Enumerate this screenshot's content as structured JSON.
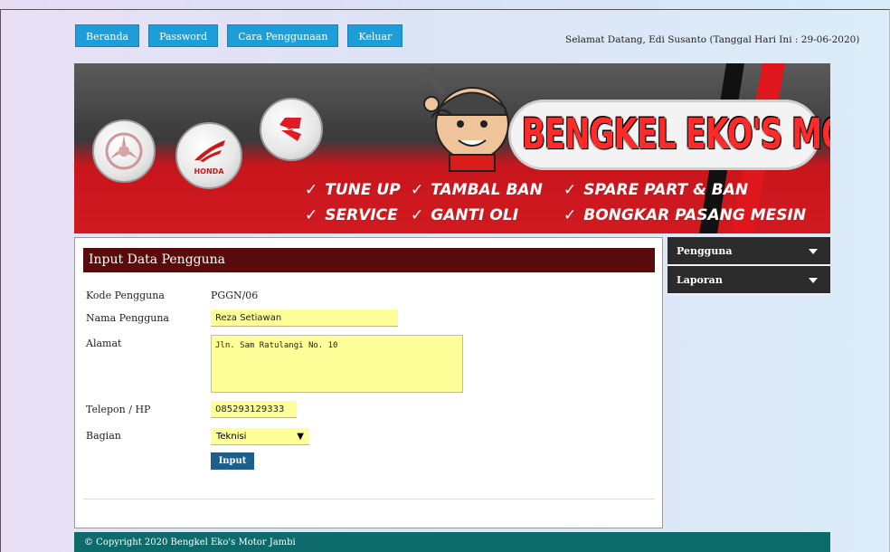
{
  "nav": {
    "items": [
      "Beranda",
      "Password",
      "Cara Penggunaan",
      "Keluar"
    ]
  },
  "header": {
    "welcome": "Selamat Datang, Edi Susanto (Tanggal Hari Ini : 29-06-2020)"
  },
  "banner": {
    "title": "BENGKEL EKO'S MOTOR JAMBI",
    "brand_honda": "HONDA",
    "services": [
      "TUNE UP",
      "TAMBAL BAN",
      "SPARE PART & BAN",
      "SERVICE",
      "GANTI OLI",
      "BONGKAR PASANG MESIN"
    ],
    "check_icon": "✓"
  },
  "form": {
    "title": "Input Data Pengguna",
    "kode_label": "Kode Pengguna",
    "kode_value": "PGGN/06",
    "nama_label": "Nama Pengguna",
    "nama_value": "Reza Setiawan",
    "alamat_label": "Alamat",
    "alamat_value": "Jln. Sam Ratulangi No. 10",
    "telepon_label": "Telepon / HP",
    "telepon_value": "085293129333",
    "bagian_label": "Bagian",
    "bagian_value": "Teknisi",
    "submit_label": "Input"
  },
  "sidebar": {
    "items": [
      {
        "label": "Pengguna"
      },
      {
        "label": "Laporan"
      }
    ]
  },
  "footer": {
    "text": "© Copyright 2020 Bengkel Eko's Motor Jambi"
  },
  "colors": {
    "nav_button": "#1e9ed8",
    "panel_head": "#5a0b0b",
    "sidebar_item": "#2b2b2b",
    "footer": "#0e6b6b",
    "input_bg": "#ffff99",
    "submit": "#1d5f8a",
    "banner_red": "#c8161d"
  }
}
